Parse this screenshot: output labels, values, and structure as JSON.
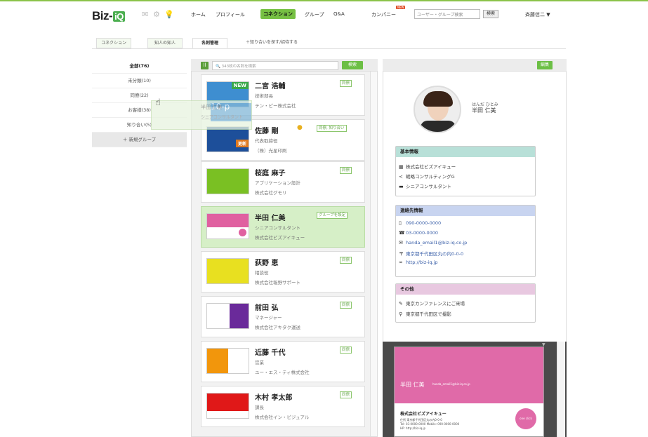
{
  "header": {
    "logo_text": "Biz-",
    "logo_box": "iQ",
    "nav": [
      "ホーム",
      "プロフィール",
      "コネクション",
      "グループ",
      "Q&A",
      "カンパニー"
    ],
    "active_nav": "コネクション",
    "new_badge": "NEW",
    "search_placeholder": "ユーザー・グループ検索",
    "search_btn": "検索",
    "username": "斉藤信二 ▼",
    "icons": [
      "mail-icon",
      "gear-icon",
      "bulb-icon"
    ]
  },
  "subtabs": [
    "コネクション",
    "知人の知人",
    "名刺管理",
    "＋知り合いを探す/招待する"
  ],
  "active_subtab": "名刺管理",
  "sidebar": {
    "items": [
      "全部(76)",
      "未分類(10)",
      "同僚(22)",
      "お客様(38)",
      "知り合い(5)",
      "＋ 新規グループ"
    ]
  },
  "toolbar": {
    "icon": "ll",
    "search_placeholder": "343枚の名刺を検索",
    "search_btn": "検索",
    "edit_btn": "編集"
  },
  "cards": [
    {
      "name": "二宮 浩輔",
      "title": "技術部長",
      "company": "テン・ピー株式会社",
      "tag": "同僚",
      "card_color": "#3e8ed0",
      "badge": "NEW"
    },
    {
      "name": "佐藤 剛",
      "title": "代表取締役",
      "company": "（株）光星印刷",
      "tag": "同僚, 知り合い",
      "card_color": "#1d4f9a",
      "badge": "更新"
    },
    {
      "name": "桜庭 麻子",
      "title": "アプリケーション設計",
      "company": "株式会社グモリ",
      "tag": "同僚",
      "card_color": "#7ac023"
    },
    {
      "name": "半田 仁美",
      "title": "シニアコンサルタント",
      "company": "株式会社ビズアイキュー",
      "tag": "グループを設定",
      "card_color": "#e060a0"
    },
    {
      "name": "荻野 恵",
      "title": "相談役",
      "company": "株式会社報野サポート",
      "tag": "同僚",
      "card_color": "#e8e020"
    },
    {
      "name": "前田 弘",
      "title": "マネージャー",
      "company": "株式会社アキタク運送",
      "tag": "同僚",
      "card_color": "#6a2a9a"
    },
    {
      "name": "近藤 千代",
      "title": "営業",
      "company": "ユー・エス・ティ株式会社",
      "tag": "同僚",
      "card_color": "#f2960c"
    },
    {
      "name": "木村 孝太郎",
      "title": "課長",
      "company": "株式会社イン・ビジュアル",
      "tag": "同僚",
      "card_color": "#e01818"
    }
  ],
  "drag_ghost": {
    "name": "半田 仁美",
    "title": "シニアコンサルタント",
    "card_label": "10-p"
  },
  "profile": {
    "kana": "はんだ ひとみ",
    "name": "半田 仁美"
  },
  "basic": {
    "title": "基本情報",
    "rows": [
      "株式会社ビズアイキュー",
      "戦略コンサルティングG",
      "シニアコンサルタント"
    ]
  },
  "contact": {
    "title": "連絡先情報",
    "rows": [
      "090-0000-0000",
      "03-0000-0000",
      "handa_email1@biz-iq.co.jp",
      "東京都千代田区丸の内0-0-0",
      "http://biz-iq.jp"
    ]
  },
  "other": {
    "title": "その他",
    "rows": [
      "東京カンファレンスにご来場",
      "東京都千代田区で撮影"
    ]
  },
  "big_card": {
    "name": "半田 仁美",
    "email": "handa_email1@biz-iq.co.jp",
    "company": "株式会社ビズアイキュー",
    "addr": "住所 東京都千代田区丸の内0-0-0",
    "tel": "Tel: 03-0000-0000  Mobile: 090-0000-0000",
    "hp": "HP: http://biz-iq.jp",
    "logo": "one click"
  },
  "colors": {
    "accent": "#76c043",
    "basic_h": "#b8e0d8",
    "contact_h": "#c8d4f0",
    "other_h": "#e8c8e0",
    "card_pink": "#e06aa8"
  }
}
